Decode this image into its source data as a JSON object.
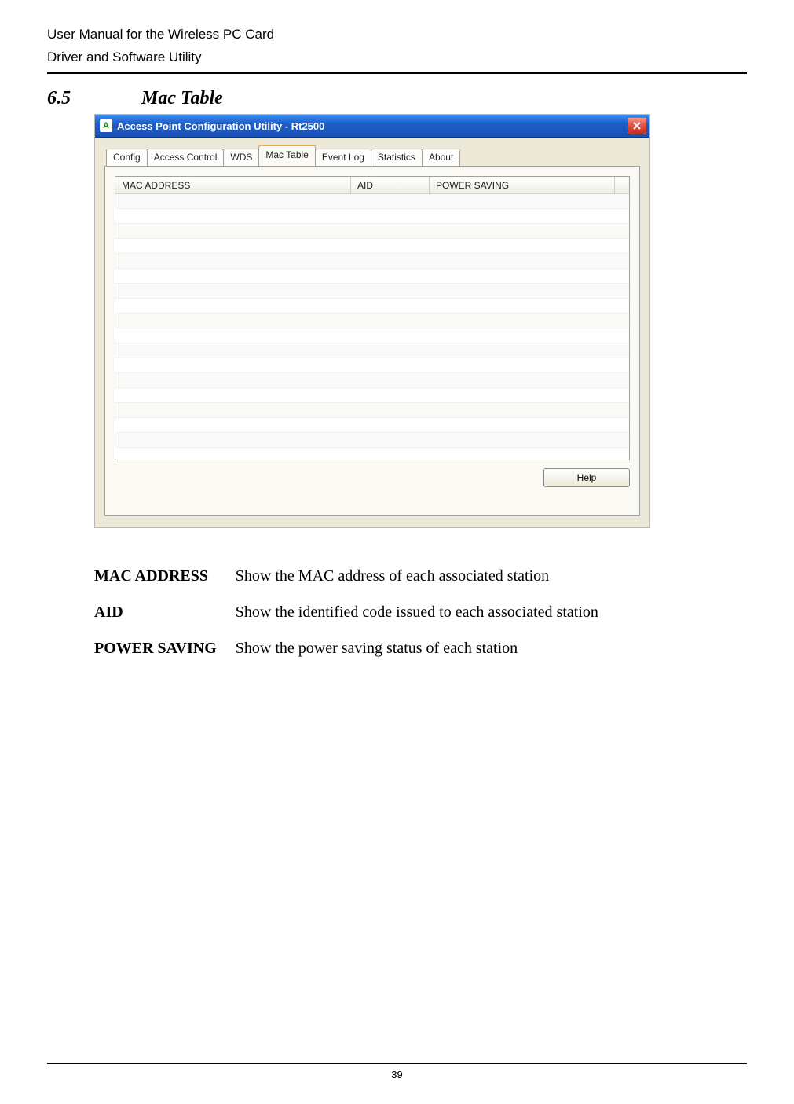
{
  "header": {
    "line1": "User Manual for the Wireless PC Card",
    "line2": "Driver and Software Utility"
  },
  "section": {
    "number": "6.5",
    "title": "Mac Table"
  },
  "screenshot": {
    "title_icon_text": "A",
    "window_title": "Access Point Configuration Utility - Rt2500",
    "tabs": {
      "config": "Config",
      "access_control": "Access Control",
      "wds": "WDS",
      "mac_table": "Mac Table",
      "event_log": "Event Log",
      "statistics": "Statistics",
      "about": "About"
    },
    "columns": {
      "mac": "MAC ADDRESS",
      "aid": "AID",
      "pwr": "POWER SAVING"
    },
    "help_label": "Help"
  },
  "definitions": [
    {
      "term": "MAC ADDRESS",
      "desc": "Show the MAC address of each associated station"
    },
    {
      "term": "AID",
      "desc": "Show the identified code issued to each associated station"
    },
    {
      "term": "POWER SAVING",
      "desc": "Show the power saving status of each station"
    }
  ],
  "page_number": "39"
}
